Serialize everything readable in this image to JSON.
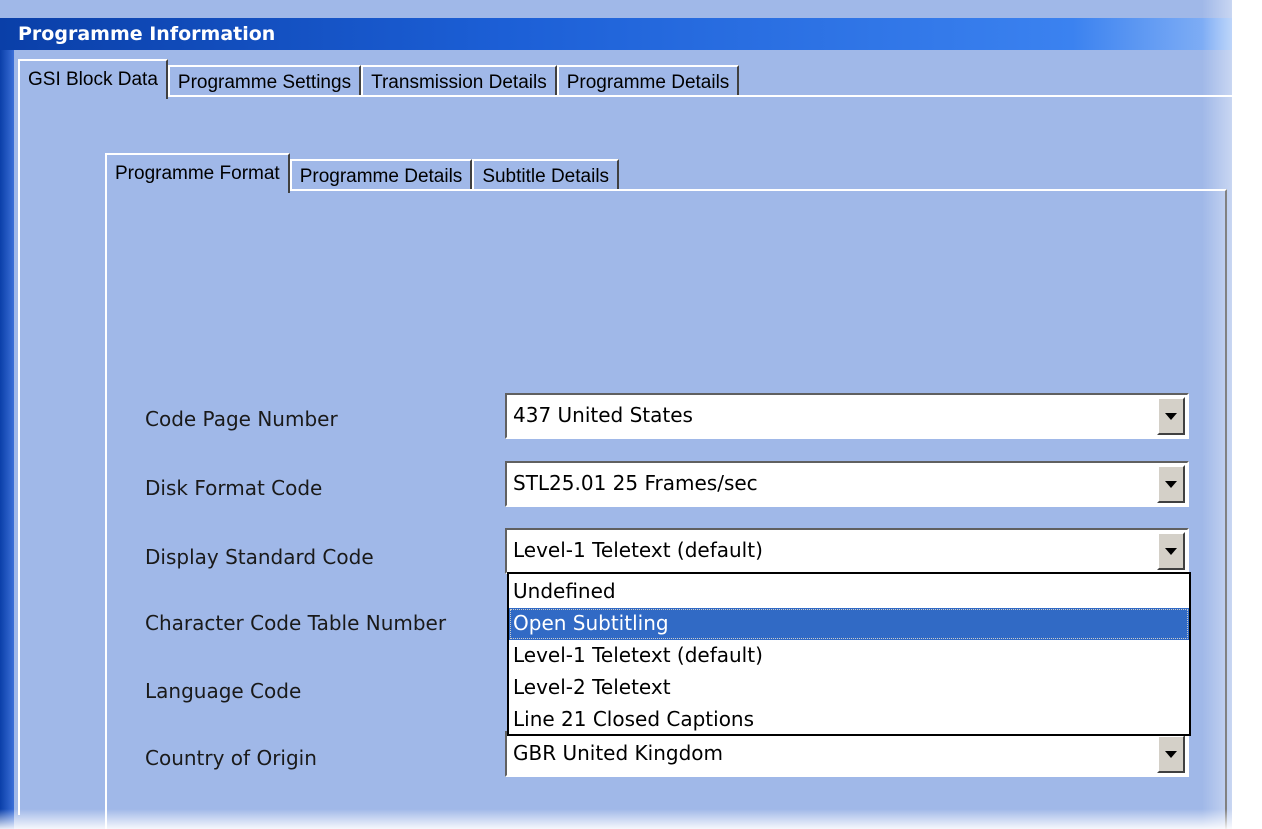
{
  "window": {
    "title": "Programme Information"
  },
  "outer_tabs": [
    {
      "label": "GSI Block Data",
      "active": true
    },
    {
      "label": "Programme Settings",
      "active": false
    },
    {
      "label": "Transmission Details",
      "active": false
    },
    {
      "label": "Programme Details",
      "active": false
    }
  ],
  "inner_tabs": [
    {
      "label": "Programme Format",
      "active": true
    },
    {
      "label": "Programme Details",
      "active": false
    },
    {
      "label": "Subtitle Details",
      "active": false
    }
  ],
  "fields": {
    "code_page": {
      "label": "Code Page Number",
      "value": "437  United States"
    },
    "disk_format": {
      "label": "Disk Format Code",
      "value": "STL25.01  25 Frames/sec"
    },
    "display_standard": {
      "label": "Display Standard Code",
      "value": "Level-1 Teletext (default)"
    },
    "char_code_table": {
      "label": "Character Code Table Number"
    },
    "language": {
      "label": "Language Code"
    },
    "country": {
      "label": "Country of Origin",
      "value": "GBR United Kingdom"
    }
  },
  "dropdown": {
    "options": [
      "Undefined",
      "Open Subtitling",
      "Level-1 Teletext (default)",
      "Level-2 Teletext",
      "Line 21 Closed Captions"
    ],
    "highlighted": "Open Subtitling"
  },
  "colors": {
    "panel": "#a0b8e8",
    "title_bar": "#1c5fd6",
    "highlight": "#316ac5"
  }
}
